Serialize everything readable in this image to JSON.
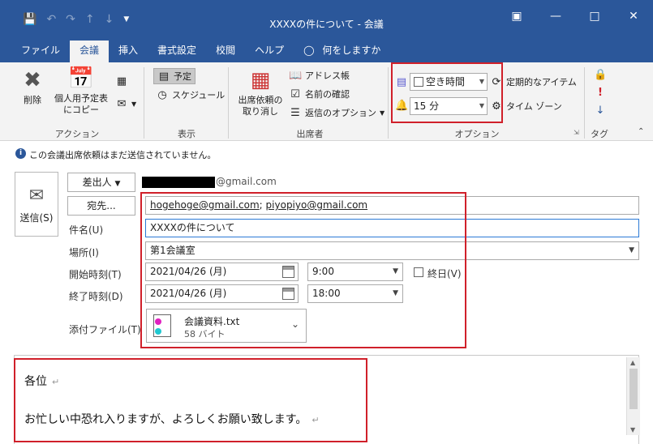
{
  "window": {
    "title": "XXXXの件について - 会議",
    "qat": [
      "save-icon",
      "undo-icon",
      "redo-icon",
      "up-icon",
      "down-icon",
      "customize-icon"
    ],
    "controls": [
      "restore-ribbon-icon",
      "minimize-icon",
      "maximize-icon",
      "close-icon"
    ]
  },
  "tabs": [
    "ファイル",
    "会議",
    "挿入",
    "書式設定",
    "校閲",
    "ヘルプ"
  ],
  "tell_me": "何をしますか",
  "ribbon": {
    "action": {
      "label": "アクション",
      "delete": "削除",
      "copy_line1": "個人用予定表",
      "copy_line2": "にコピー"
    },
    "show": {
      "label": "表示",
      "appointment": "予定",
      "scheduling": "スケジュール"
    },
    "attendees": {
      "label": "出席者",
      "cancel_line1": "出席依頼の",
      "cancel_line2": "取り消し",
      "address_book": "アドレス帳",
      "check_names": "名前の確認",
      "response_options": "返信のオプション"
    },
    "options": {
      "label": "オプション",
      "show_as": "空き時間",
      "reminder": "15 分",
      "recurrence": "定期的なアイテム",
      "time_zones": "タイム ゾーン"
    },
    "tags": {
      "label": "タグ"
    }
  },
  "info": "この会議出席依頼はまだ送信されていません。",
  "form": {
    "send": "送信(S)",
    "from_button": "差出人",
    "from_email_suffix": "@gmail.com",
    "to_button": "宛先...",
    "to_1": "hogehoge@gmail.com",
    "to_sep": ";",
    "to_2": "piyopiyo@gmail.com",
    "subject_label": "件名(U)",
    "subject": "XXXXの件について",
    "location_label": "場所(I)",
    "location": "第1会議室",
    "start_label": "開始時刻(T)",
    "start_date": "2021/04/26 (月)",
    "start_time": "9:00",
    "allday_label": "終日(V)",
    "end_label": "終了時刻(D)",
    "end_date": "2021/04/26 (月)",
    "end_time": "18:00",
    "attach_label": "添付ファイル(T)",
    "attachment_name": "会議資料.txt",
    "attachment_size": "58 バイト"
  },
  "body": {
    "line1": "各位",
    "line2": "お忙しい中恐れ入りますが、よろしくお願い致します。"
  },
  "colors": {
    "accent": "#2b579a",
    "highlight": "#d0202a"
  }
}
